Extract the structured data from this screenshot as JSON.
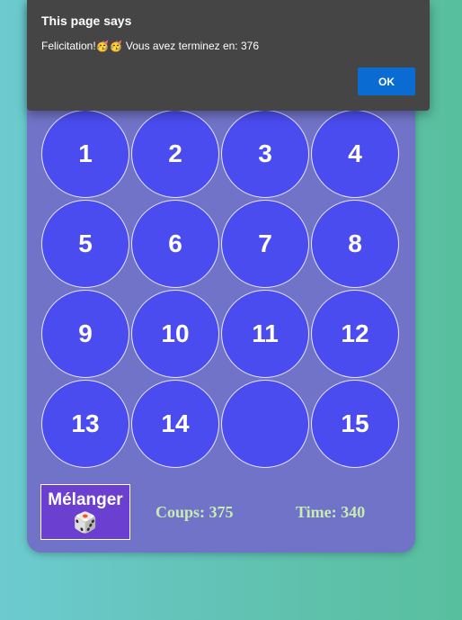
{
  "dialog": {
    "title": "This page says",
    "message": "Felicitation!🥳🥳 Vous avez terminez en: 376",
    "ok_label": "OK"
  },
  "board": {
    "tiles": [
      "1",
      "2",
      "3",
      "4",
      "5",
      "6",
      "7",
      "8",
      "9",
      "10",
      "11",
      "12",
      "13",
      "14",
      "",
      "15"
    ]
  },
  "controls": {
    "shuffle_label": "Mélanger",
    "shuffle_icon": "🎲",
    "moves": "Coups: 375",
    "time": "Time: 340"
  },
  "colors": {
    "background_left": "#6ccbd0",
    "background_right": "#58bf9d",
    "card": "#7173c8",
    "tile": "#4a4cf0",
    "shuffle_button": "#6b3fd0",
    "stat_text": "#c8ecb0",
    "dialog_bg": "#454545",
    "dialog_button": "#0a6cd2"
  }
}
